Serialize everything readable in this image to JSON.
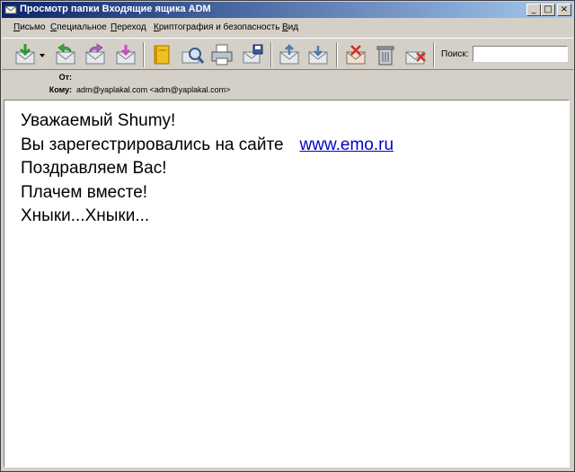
{
  "window": {
    "title": "Просмотр папки Входящие ящика ADM",
    "buttons": {
      "minimize": "_",
      "maximize": "□",
      "close": "×"
    }
  },
  "menu": [
    {
      "accel": "П",
      "rest": "исьмо"
    },
    {
      "accel": "С",
      "rest": "пециальное"
    },
    {
      "accel": "П",
      "rest": "ереход"
    },
    {
      "accel": "К",
      "rest": "риптография и безопасность"
    },
    {
      "accel": "В",
      "rest": "ид"
    }
  ],
  "toolbar": {
    "icons": [
      "get-mail-icon",
      "dropdown-arrow-icon",
      "reply-icon",
      "forward-icon",
      "new-message-icon",
      "address-book-icon",
      "search-mail-icon",
      "print-icon",
      "save-icon",
      "previous-message-icon",
      "next-message-icon",
      "mark-junk-icon",
      "delete-icon",
      "not-junk-icon"
    ],
    "search_label": "Поиск:",
    "search_value": ""
  },
  "headers": {
    "from_label": "От:",
    "from_value": "",
    "to_label": "Кому:",
    "to_value": "adm@yaplakal.com <adm@yaplakal.com>"
  },
  "message": {
    "line1": "Уважаемый Shumy!",
    "line2_text": "Вы зарегестрировались на сайте",
    "line2_link": "www.emo.ru",
    "line3": "Поздравляем Вас!",
    "line4": "Плачем вместе!",
    "line5": "Хныки...Хныки..."
  },
  "colors": {
    "titlebar_start": "#0a246a",
    "titlebar_end": "#a6caf0",
    "link": "#0000cc",
    "chrome": "#d4d0c8"
  }
}
